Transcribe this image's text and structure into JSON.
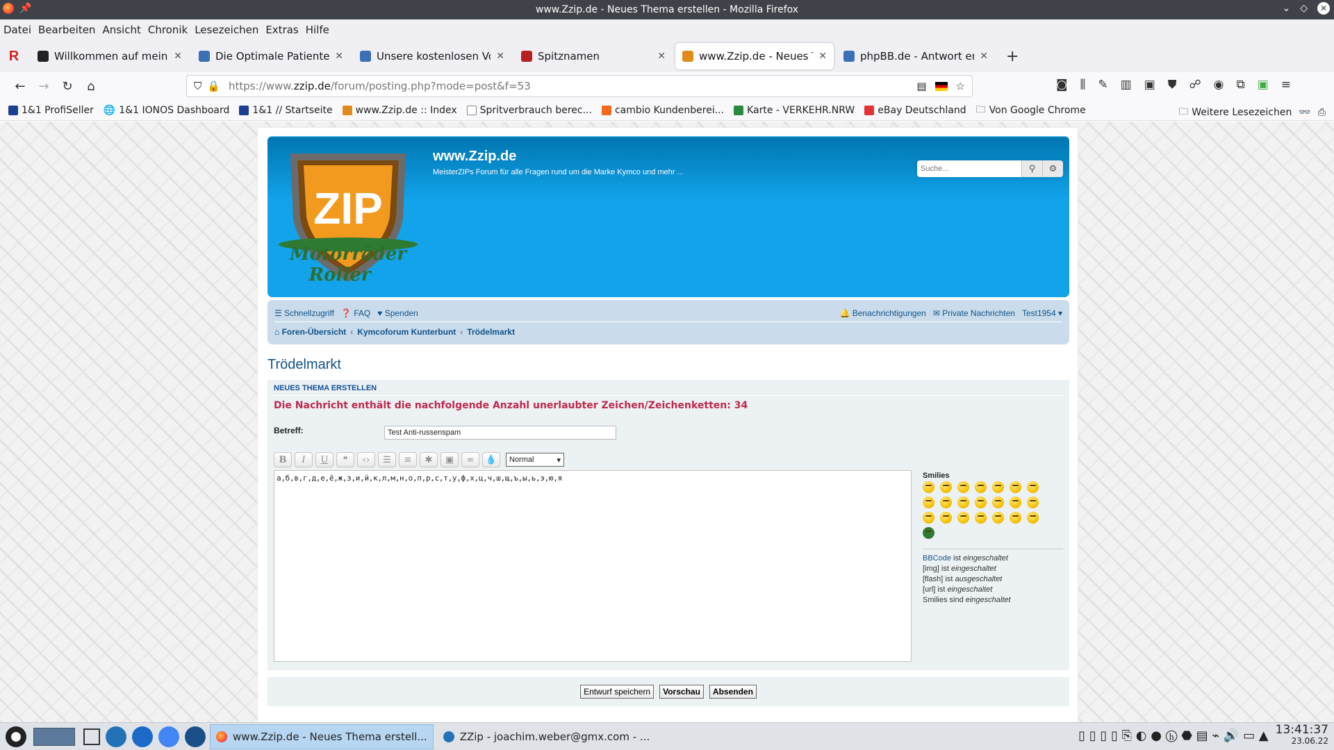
{
  "window": {
    "title": "www.Zzip.de - Neues Thema erstellen - Mozilla Firefox"
  },
  "menu": [
    "Datei",
    "Bearbeiten",
    "Ansicht",
    "Chronik",
    "Lesezeichen",
    "Extras",
    "Hilfe"
  ],
  "tabs": [
    {
      "label": "Willkommen auf meiner H",
      "icon_color": "#222222"
    },
    {
      "label": "Die Optimale Patientenve",
      "icon_color": "#3b6fb6"
    },
    {
      "label": "Unsere kostenlosen Vorsc",
      "icon_color": "#3b6fb6"
    },
    {
      "label": "Spitznamen",
      "icon_color": "#b52020"
    },
    {
      "label": "www.Zzip.de - Neues The",
      "icon_color": "#e08a1e"
    },
    {
      "label": "phpBB.de - Antwort erste",
      "icon_color": "#3b6fb6"
    }
  ],
  "url": {
    "prefix": "https://www.",
    "host": "zzip.de",
    "path": "/forum/posting.php?mode=post&f=53"
  },
  "bookmarks": [
    "1&1 ProfiSeller",
    "1&1 IONOS Dashboard",
    "1&1 // Startseite",
    "www.Zzip.de :: Index",
    "Spritverbrauch berec...",
    "cambio Kundenberei...",
    "Karte - VERKEHR.NRW",
    "eBay Deutschland",
    "Von Google Chrome"
  ],
  "bookmarks_more": "Weitere Lesezeichen",
  "site": {
    "title": "www.Zzip.de",
    "description": "MeisterZIPs Forum für alle Fragen rund um die Marke Kymco und mehr ...",
    "logo_text": "ZIP",
    "logo_script_1": "Motorräder",
    "logo_script_2": "Roller",
    "search_placeholder": "Suche..."
  },
  "nav": {
    "quicklinks": "Schnellzugriff",
    "faq": "FAQ",
    "donate": "Spenden",
    "notifications": "Benachrichtigungen",
    "pm": "Private Nachrichten",
    "user": "Test1954",
    "breadcrumbs": [
      "Foren-Übersicht",
      "Kymcoforum Kunterbunt",
      "Trödelmarkt"
    ]
  },
  "forum_title": "Trödelmarkt",
  "post": {
    "heading": "Neues Thema erstellen",
    "error": "Die Nachricht enthält die nachfolgende Anzahl unerlaubter Zeichen/Zeichenketten: 34",
    "subject_label": "Betreff:",
    "subject_value": "Test Anti-russenspam",
    "font_size": "Normal",
    "message": "а,б,в,г,д,е,ё,ж,з,и,й,к,л,м,н,о,п,р,с,т,у,ф,х,ц,ч,ш,щ,ъ,ы,ь,э,ю,я",
    "smilies_label": "Smilies",
    "bbinfo": [
      {
        "name": "BBCode",
        "text": " ist ",
        "state": "eingeschaltet"
      },
      {
        "name": "[img]",
        "text": " ist ",
        "state": "eingeschaltet"
      },
      {
        "name": "[flash]",
        "text": " ist ",
        "state": "ausgeschaltet"
      },
      {
        "name": "[url]",
        "text": " ist ",
        "state": "eingeschaltet"
      },
      {
        "name": "Smilies",
        "text": " sind ",
        "state": "eingeschaltet"
      }
    ],
    "buttons": {
      "draft": "Entwurf speichern",
      "preview": "Vorschau",
      "submit": "Absenden"
    }
  },
  "taskbar": {
    "apps": [
      "www.Zzip.de - Neues Thema erstell...",
      "ZZip - joachim.weber@gmx.com - ..."
    ],
    "time": "13:41:37",
    "date": "23.06.22"
  }
}
